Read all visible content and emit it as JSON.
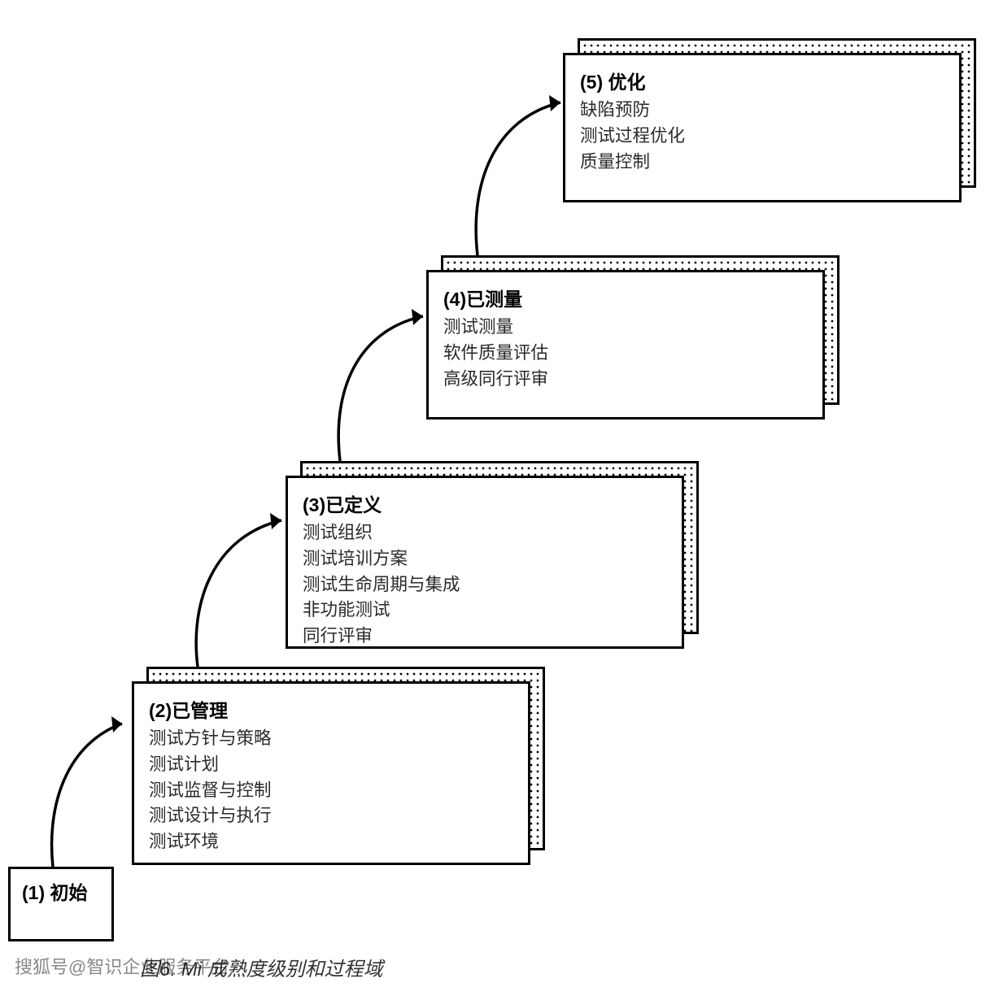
{
  "levels": {
    "l1": {
      "title": "(1) 初始",
      "items": []
    },
    "l2": {
      "title": "(2)已管理",
      "items": [
        "测试方针与策略",
        "测试计划",
        "测试监督与控制",
        "测试设计与执行",
        "测试环境"
      ]
    },
    "l3": {
      "title": "(3)已定义",
      "items": [
        "测试组织",
        "测试培训方案",
        "测试生命周期与集成",
        "非功能测试",
        "同行评审"
      ]
    },
    "l4": {
      "title": "(4)已测量",
      "items": [
        "测试测量",
        "软件质量评估",
        "高级同行评审"
      ]
    },
    "l5": {
      "title": "(5) 优化",
      "items": [
        "缺陷预防",
        "测试过程优化",
        "质量控制"
      ]
    }
  },
  "caption_prefix": "图6.",
  "caption_title": "Mi 成熟度级别和过程域",
  "watermark": "搜狐号@智识企业服务平台"
}
